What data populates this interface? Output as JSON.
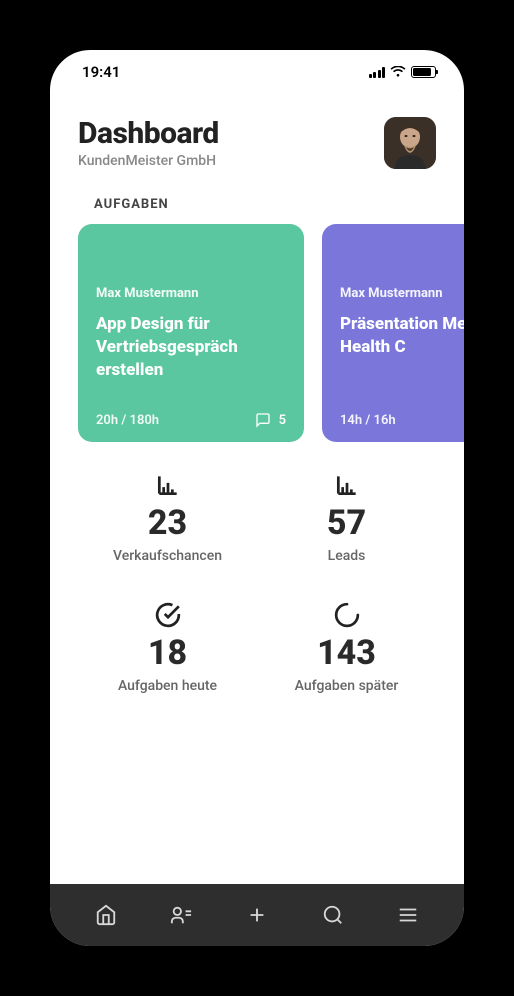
{
  "status": {
    "time": "19:41"
  },
  "header": {
    "title": "Dashboard",
    "subtitle": "KundenMeister GmbH"
  },
  "tasks": {
    "label": "AUFGABEN",
    "cards": [
      {
        "owner": "Max Mustermann",
        "title": "App Design für Vertriebsgespräch erstellen",
        "hours": "20h  /  180h",
        "comments": "5",
        "color": "green"
      },
      {
        "owner": "Max Mustermann",
        "title": "Präsentation Medical Health C",
        "hours": "14h  /  16h",
        "comments": "",
        "color": "purple"
      }
    ]
  },
  "stats": [
    {
      "icon": "bar-chart",
      "value": "23",
      "label": "Verkaufschancen"
    },
    {
      "icon": "bar-chart",
      "value": "57",
      "label": "Leads"
    },
    {
      "icon": "check-circle",
      "value": "18",
      "label": "Aufgaben heute"
    },
    {
      "icon": "progress",
      "value": "143",
      "label": "Aufgaben später"
    }
  ],
  "nav": {
    "items": [
      "home",
      "contacts",
      "add",
      "search",
      "menu"
    ]
  }
}
